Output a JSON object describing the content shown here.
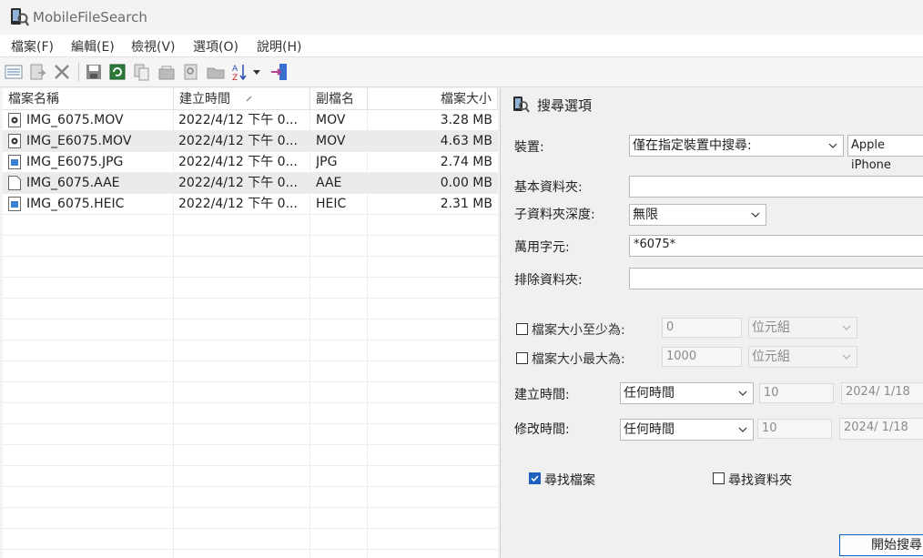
{
  "window": {
    "title": "MobileFileSearch"
  },
  "menu": [
    "檔案(F)",
    "編輯(E)",
    "檢視(V)",
    "選項(O)",
    "說明(H)"
  ],
  "toolbar": [
    "report-icon",
    "export-icon",
    "delete-icon",
    "save-icon",
    "refresh-icon",
    "copy-icon",
    "properties-icon",
    "find-icon",
    "open-folder-icon",
    "sort-icon",
    "exit-icon"
  ],
  "list": {
    "columns": [
      "檔案名稱",
      "建立時間",
      "副檔名",
      "檔案大小"
    ],
    "rows": [
      {
        "name": "IMG_6075.MOV",
        "created": "2022/4/12 下午 0...",
        "ext": "MOV",
        "size": "3.28 MB",
        "icon": "video-file-icon"
      },
      {
        "name": "IMG_E6075.MOV",
        "created": "2022/4/12 下午 0...",
        "ext": "MOV",
        "size": "4.63 MB",
        "icon": "video-file-icon"
      },
      {
        "name": "IMG_E6075.JPG",
        "created": "2022/4/12 下午 0...",
        "ext": "JPG",
        "size": "2.74 MB",
        "icon": "image-file-icon"
      },
      {
        "name": "IMG_6075.AAE",
        "created": "2022/4/12 下午 0...",
        "ext": "AAE",
        "size": "0.00 MB",
        "icon": "blank-file-icon"
      },
      {
        "name": "IMG_6075.HEIC",
        "created": "2022/4/12 下午 0...",
        "ext": "HEIC",
        "size": "2.31 MB",
        "icon": "image-file-icon"
      }
    ]
  },
  "panel": {
    "title": "搜尋選項",
    "device_label": "裝置:",
    "device_mode": "僅在指定裝置中搜尋:",
    "device_name": "Apple iPhone",
    "base_folder_label": "基本資料夾:",
    "base_folder_value": "",
    "subfolder_depth_label": "子資料夾深度:",
    "subfolder_depth_value": "無限",
    "wildcard_label": "萬用字元:",
    "wildcard_value": "*6075*",
    "exclude_label": "排除資料夾:",
    "exclude_value": "",
    "min_size_label": "檔案大小至少為:",
    "min_size_value": "0",
    "min_size_unit": "位元組",
    "max_size_label": "檔案大小最大為:",
    "max_size_value": "1000",
    "max_size_unit": "位元組",
    "created_label": "建立時間:",
    "created_mode": "任何時間",
    "created_num": "10",
    "created_date": "2024/  1/18",
    "modified_label": "修改時間:",
    "modified_mode": "任何時間",
    "modified_num": "10",
    "modified_date": "2024/  1/18",
    "find_files_label": "尋找檔案",
    "find_folders_label": "尋找資料夾",
    "start_button": "開始搜尋"
  }
}
